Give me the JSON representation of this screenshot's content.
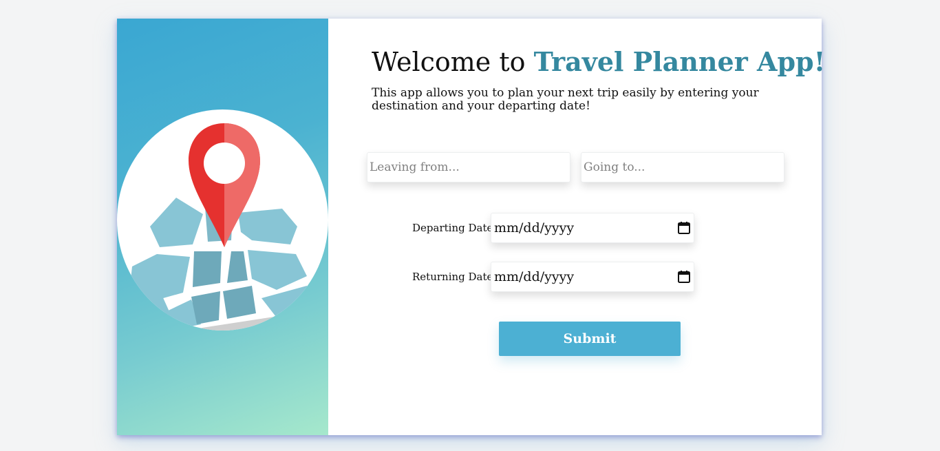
{
  "header": {
    "welcome_prefix": "Welcome to ",
    "brand_name": "Travel Planner App!",
    "intro": "This app allows you to plan your next trip easily by entering your destination and your departing date!"
  },
  "form": {
    "leaving_from": {
      "value": "",
      "placeholder": "Leaving from..."
    },
    "going_to": {
      "value": "",
      "placeholder": "Going to..."
    },
    "departing": {
      "label": "Departing Date",
      "value_display": "mm/dd/yyyy"
    },
    "returning": {
      "label": "Returning Date",
      "value_display": "mm/dd/yyyy"
    },
    "submit_label": "Submit"
  },
  "colors": {
    "brand": "#35889f",
    "button": "#4cb0d3",
    "gradient_start": "#3aa7d2",
    "gradient_end": "#a6e8cc",
    "pin_red": "#e5312f"
  },
  "icons": {
    "hero": "map-location-pin-icon",
    "date_picker": "calendar-icon"
  }
}
